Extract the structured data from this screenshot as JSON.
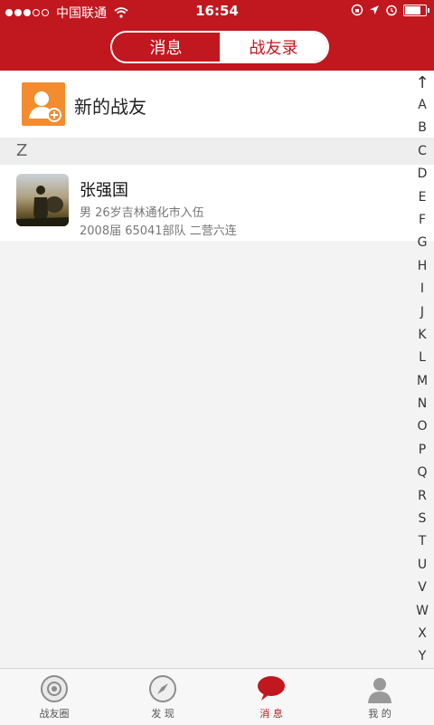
{
  "status_bar": {
    "carrier": "中国联通",
    "time": "16:54"
  },
  "header": {
    "segments": [
      {
        "label": "消息",
        "active": false
      },
      {
        "label": "战友录",
        "active": true
      }
    ]
  },
  "new_friend": {
    "label": "新的战友",
    "icon": "add-person-icon"
  },
  "section_header": "Z",
  "contacts": [
    {
      "name": "张强国",
      "line1": "男 26岁吉林通化市入伍",
      "line2": "2008届 65041部队 二营六连"
    }
  ],
  "index_bar": {
    "top_symbol": "↑",
    "letters": [
      "A",
      "B",
      "C",
      "D",
      "E",
      "F",
      "G",
      "H",
      "I",
      "J",
      "K",
      "L",
      "M",
      "N",
      "O",
      "P",
      "Q",
      "R",
      "S",
      "T",
      "U",
      "V",
      "W",
      "X",
      "Y"
    ]
  },
  "tabs": [
    {
      "label": "战友圈",
      "icon": "circle-icon",
      "active": false
    },
    {
      "label": "发 现",
      "icon": "compass-icon",
      "active": false
    },
    {
      "label": "消 息",
      "icon": "chat-bubble-icon",
      "active": true
    },
    {
      "label": "我 的",
      "icon": "person-icon",
      "active": false
    }
  ],
  "colors": {
    "brand_red": "#c1171f",
    "new_friend_orange": "#f28c2e"
  }
}
